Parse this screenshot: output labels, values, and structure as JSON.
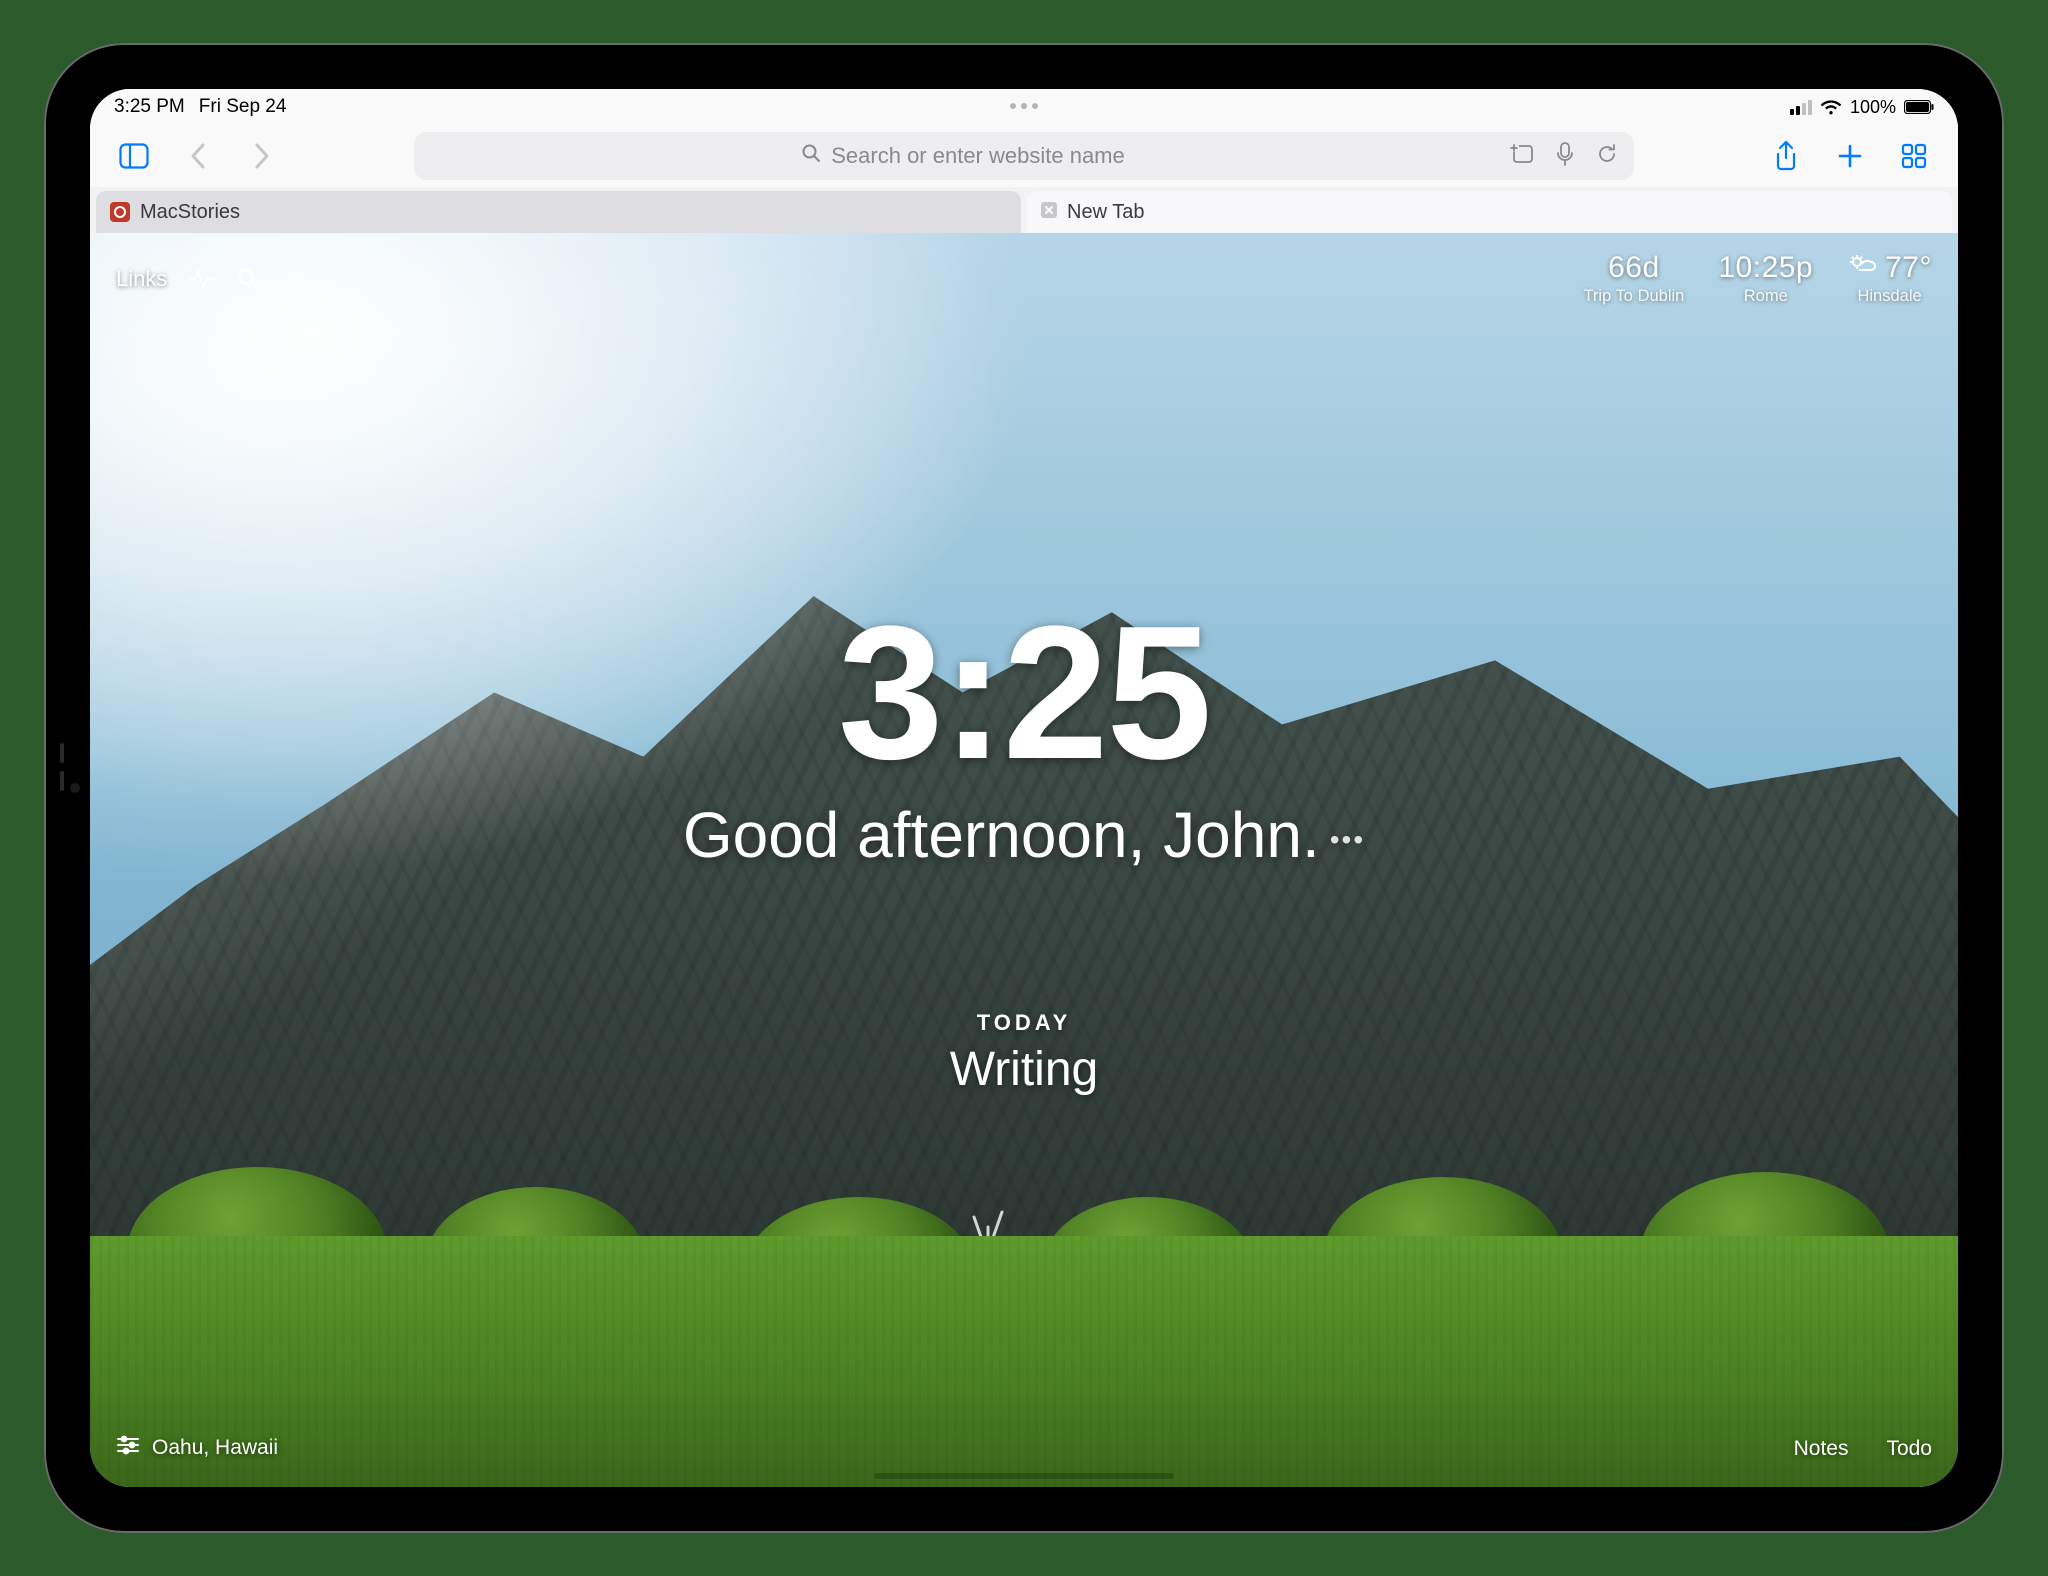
{
  "statusbar": {
    "time": "3:25 PM",
    "date": "Fri Sep 24",
    "battery_pct": "100%"
  },
  "safari": {
    "search_placeholder": "Search or enter website name",
    "tabs": [
      {
        "title": "MacStories"
      },
      {
        "title": "New Tab"
      }
    ]
  },
  "momentum": {
    "top_left": {
      "links_label": "Links"
    },
    "widgets": {
      "countdown": {
        "value": "66d",
        "label": "Trip To Dublin"
      },
      "world_clock": {
        "value": "10:25p",
        "label": "Rome"
      },
      "weather": {
        "value": "77°",
        "label": "Hinsdale"
      }
    },
    "clock": "3:25",
    "greeting": "Good afternoon, John.",
    "focus": {
      "label": "TODAY",
      "task": "Writing"
    },
    "bottom": {
      "location": "Oahu, Hawaii",
      "notes": "Notes",
      "todo": "Todo"
    }
  }
}
